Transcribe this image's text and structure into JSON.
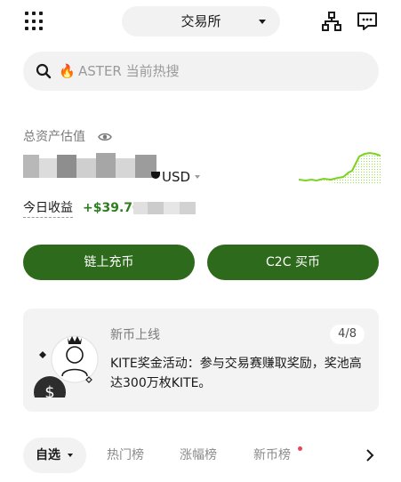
{
  "header": {
    "exchange_label": "交易所",
    "menu_icon": "grid-menu-icon",
    "network_icon": "network-icon",
    "message_icon": "message-icon"
  },
  "search": {
    "icon": "search-icon",
    "hot_icon": "🔥",
    "placeholder": "ASTER 当前热搜"
  },
  "assets": {
    "label": "总资产估值",
    "visibility_icon": "eye-icon",
    "currency": "USD",
    "pnl_label": "今日收益",
    "pnl_value": "+$39.70",
    "accent_color": "#2e6a1c",
    "pnl_color": "#2e7d1f",
    "sparkline_color": "#7bd321"
  },
  "actions": {
    "deposit_label": "链上充币",
    "c2c_label": "C2C 买币"
  },
  "promo": {
    "title": "新币上线",
    "counter": "4/8",
    "text": "KITE奖金活动：参与交易赛赚取奖励，奖池高达300万枚KITE。"
  },
  "tabs": {
    "items": [
      "自选",
      "热门榜",
      "涨幅榜",
      "新币榜"
    ],
    "new_badge_color": "#e8465a"
  }
}
